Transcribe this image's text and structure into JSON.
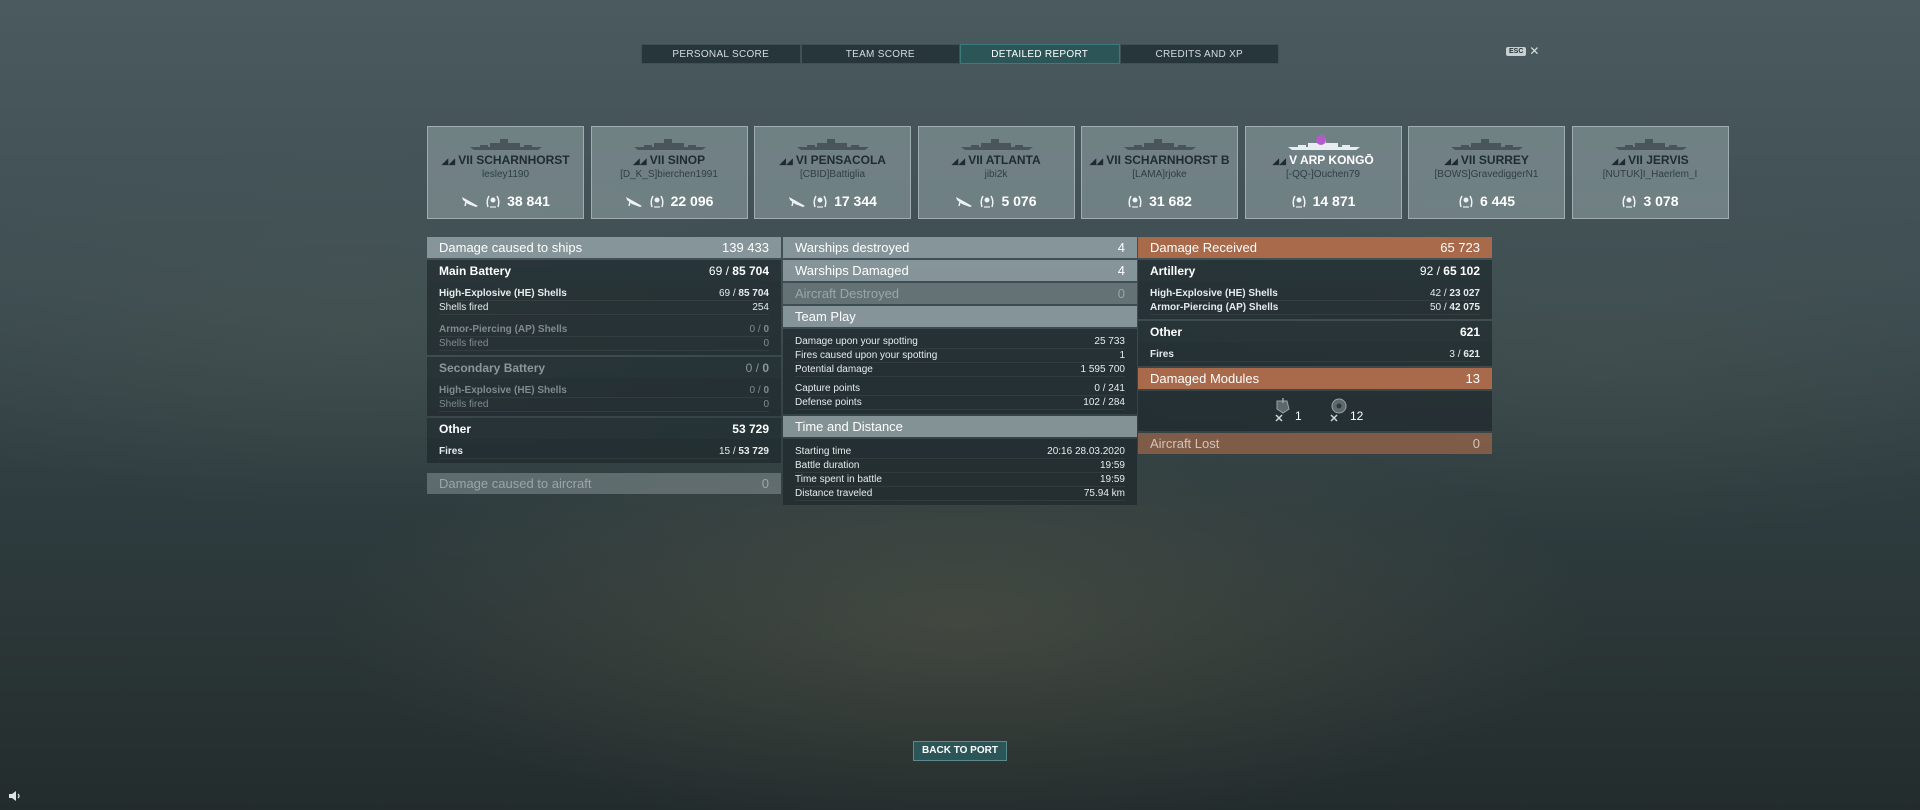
{
  "tabs": [
    {
      "label": "PERSONAL SCORE",
      "active": false
    },
    {
      "label": "TEAM SCORE",
      "active": false
    },
    {
      "label": "DETAILED REPORT",
      "active": true
    },
    {
      "label": "CREDITS AND XP",
      "active": false
    }
  ],
  "esc": {
    "key": "ESC",
    "close": "✕"
  },
  "ships": [
    {
      "tier": "VII",
      "name": "SCHARNHORST",
      "player": "lesley1190",
      "score": "38 841",
      "plane": true
    },
    {
      "tier": "VII",
      "name": "SINOP",
      "player": "[D_K_S]bierchen1991",
      "score": "22 096",
      "plane": true
    },
    {
      "tier": "VI",
      "name": "PENSACOLA",
      "player": "[CBID]Battiglia",
      "score": "17 344",
      "plane": true
    },
    {
      "tier": "VII",
      "name": "ATLANTA",
      "player": "jibi2k",
      "score": "5 076",
      "plane": true
    },
    {
      "tier": "VII",
      "name": "SCHARNHORST B",
      "player": "[LAMA]rjoke",
      "score": "31 682",
      "plane": false
    },
    {
      "tier": "V",
      "name": "ARP KONGŌ",
      "player": "[-QQ-]Ouchen79",
      "score": "14 871",
      "plane": false
    },
    {
      "tier": "VII",
      "name": "SURREY",
      "player": "[BOWS]GravediggerN1",
      "score": "6 445",
      "plane": false
    },
    {
      "tier": "VII",
      "name": "JERVIS",
      "player": "[NUTUK]I_Haerlem_I",
      "score": "3 078",
      "plane": false
    }
  ],
  "damage_ships": {
    "label": "Damage caused to ships",
    "value": "139 433",
    "main_battery": {
      "label": "Main Battery",
      "hits": "69",
      "sep": " / ",
      "value": "85 704"
    },
    "he_shells": {
      "label": "High-Explosive (HE) Shells",
      "hits": "69",
      "value": "85 704"
    },
    "shells_fired_1": {
      "label": "Shells fired",
      "value": "254"
    },
    "ap_shells": {
      "label": "Armor-Piercing (AP) Shells",
      "hits": "0",
      "value": "0"
    },
    "shells_fired_2": {
      "label": "Shells fired",
      "value": "0"
    },
    "secondary": {
      "label": "Secondary Battery",
      "hits": "0",
      "value": "0"
    },
    "sec_he": {
      "label": "High-Explosive (HE) Shells",
      "hits": "0",
      "value": "0"
    },
    "shells_fired_3": {
      "label": "Shells fired",
      "value": "0"
    },
    "other": {
      "label": "Other",
      "value": "53 729"
    },
    "fires": {
      "label": "Fires",
      "hits": "15",
      "value": "53 729"
    }
  },
  "damage_aircraft": {
    "label": "Damage caused to aircraft",
    "value": "0"
  },
  "warships_destroyed": {
    "label": "Warships destroyed",
    "value": "4"
  },
  "warships_damaged": {
    "label": "Warships Damaged",
    "value": "4"
  },
  "aircraft_destroyed": {
    "label": "Aircraft Destroyed",
    "value": "0"
  },
  "team_play": {
    "label": "Team Play",
    "rows": [
      {
        "label": "Damage upon your spotting",
        "value": "25 733"
      },
      {
        "label": "Fires caused upon your spotting",
        "value": "1"
      },
      {
        "label": "Potential damage",
        "value": "1 595 700"
      },
      {
        "label": "Capture points",
        "value": "0 / 241"
      },
      {
        "label": "Defense points",
        "value": "102 / 284"
      }
    ]
  },
  "time_distance": {
    "label": "Time and Distance",
    "rows": [
      {
        "label": "Starting time",
        "value": "20:16  28.03.2020"
      },
      {
        "label": "Battle duration",
        "value": "19:59"
      },
      {
        "label": "Time spent in battle",
        "value": "19:59"
      },
      {
        "label": "Distance traveled",
        "value": "75.94 km"
      }
    ]
  },
  "damage_received": {
    "label": "Damage Received",
    "value": "65 723",
    "artillery": {
      "label": "Artillery",
      "hits": "92",
      "value": "65 102"
    },
    "he_shells": {
      "label": "High-Explosive (HE) Shells",
      "hits": "42",
      "value": "23 027"
    },
    "ap_shells": {
      "label": "Armor-Piercing (AP) Shells",
      "hits": "50",
      "value": "42 075"
    },
    "other": {
      "label": "Other",
      "value": "621"
    },
    "fires": {
      "label": "Fires",
      "hits": "3",
      "value": "621"
    }
  },
  "damaged_modules": {
    "label": "Damaged Modules",
    "value": "13",
    "items": [
      {
        "icon": "rudder-icon",
        "count": "1"
      },
      {
        "icon": "engine-icon",
        "count": "12"
      }
    ]
  },
  "aircraft_lost": {
    "label": "Aircraft Lost",
    "value": "0"
  },
  "back_button": "BACK TO PORT"
}
